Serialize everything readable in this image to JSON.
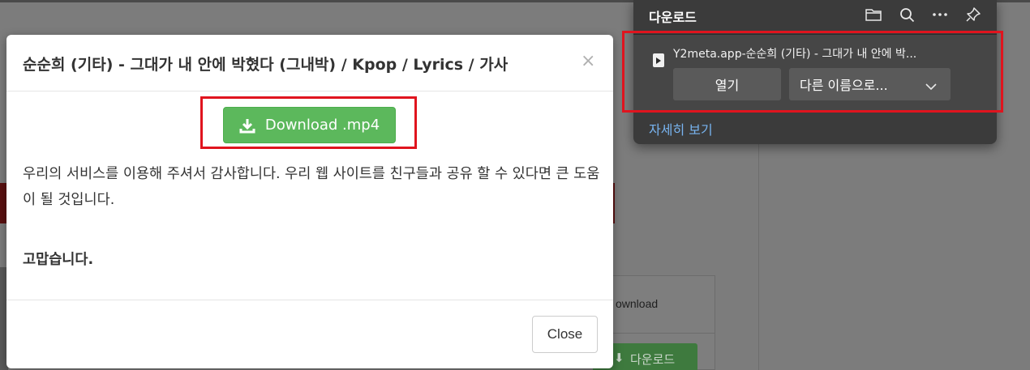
{
  "background": {
    "card_text": "ownload",
    "green_button_label": "다운로드"
  },
  "modal": {
    "title": "순순희 (기타) - 그대가 내 안에 박혔다 (그내박) / Kpop / Lyrics / 가사",
    "close_glyph": "×",
    "download_button_label": "Download .mp4",
    "message": "우리의 서비스를 이용해 주셔서 감사합니다. 우리 웹 사이트를 친구들과 공유 할 수 있다면 큰 도움이 될 것입니다.",
    "thanks": "고맙습니다.",
    "close_button_label": "Close"
  },
  "downloads_panel": {
    "title": "다운로드",
    "icons": [
      "folder-icon",
      "search-icon",
      "more-icon",
      "pin-icon"
    ],
    "item": {
      "file_name": "Y2meta.app-순순희 (기타) - 그대가 내 안에 박...",
      "open_button_label": "열기",
      "save_as_button_label": "다른 이름으로..."
    },
    "see_more_link": "자세히 보기"
  },
  "colors": {
    "highlight_red": "#e0141e",
    "download_green": "#5cb85c",
    "panel_bg": "#3b3b3b",
    "link_blue": "#78b4f0"
  }
}
